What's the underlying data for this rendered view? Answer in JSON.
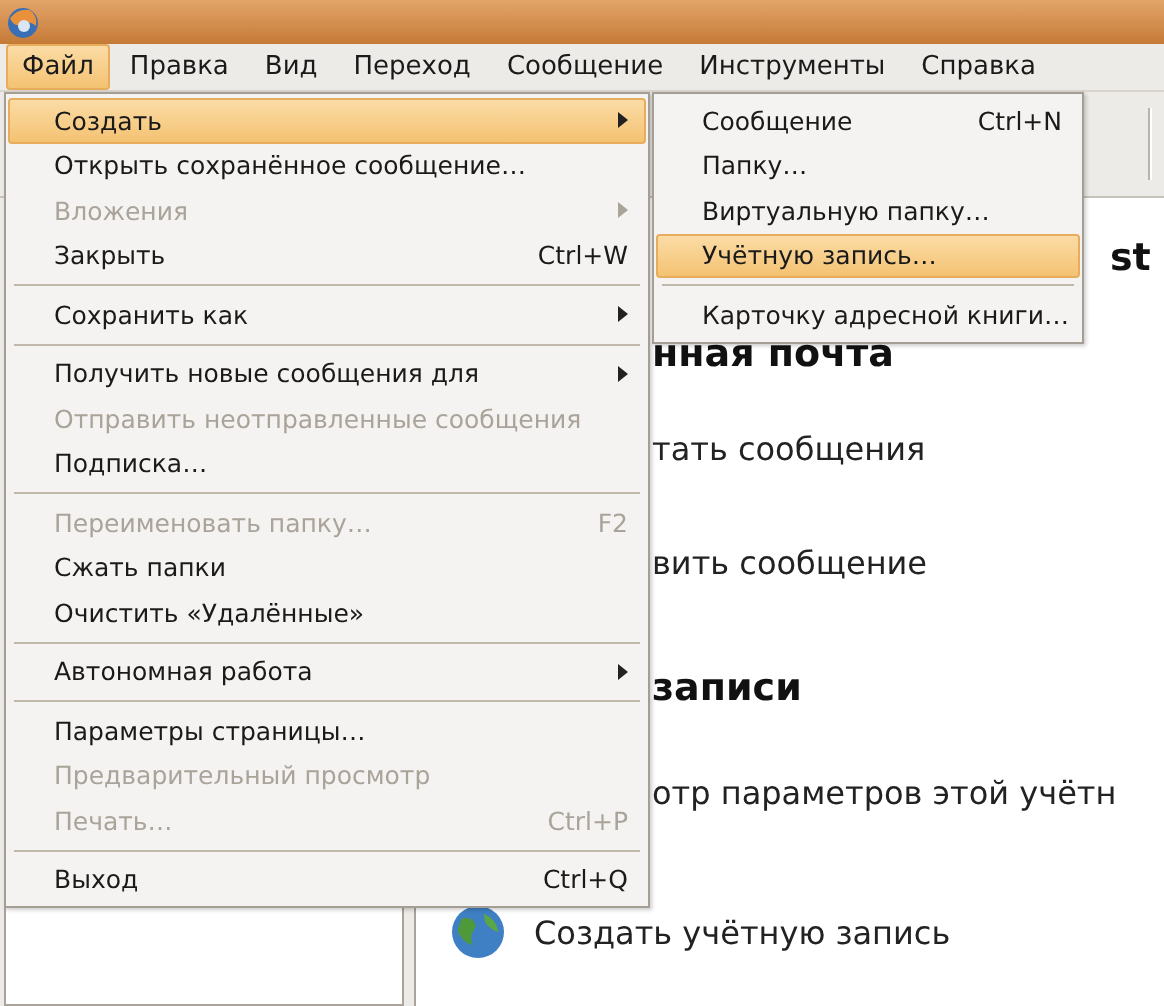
{
  "menubar": [
    {
      "label": "Файл",
      "selected": true
    },
    {
      "label": "Правка",
      "selected": false
    },
    {
      "label": "Вид",
      "selected": false
    },
    {
      "label": "Переход",
      "selected": false
    },
    {
      "label": "Сообщение",
      "selected": false
    },
    {
      "label": "Инструменты",
      "selected": false
    },
    {
      "label": "Справка",
      "selected": false
    }
  ],
  "file_menu": [
    {
      "kind": "item",
      "label": "Создать",
      "submenu": true,
      "selected": true,
      "disabled": false
    },
    {
      "kind": "item",
      "label": "Открыть сохранённое сообщение…",
      "selected": false,
      "disabled": false
    },
    {
      "kind": "item",
      "label": "Вложения",
      "submenu": true,
      "selected": false,
      "disabled": true
    },
    {
      "kind": "item",
      "label": "Закрыть",
      "shortcut": "Ctrl+W",
      "selected": false,
      "disabled": false
    },
    {
      "kind": "separator"
    },
    {
      "kind": "item",
      "label": "Сохранить как",
      "submenu": true,
      "selected": false,
      "disabled": false
    },
    {
      "kind": "separator"
    },
    {
      "kind": "item",
      "label": "Получить новые сообщения для",
      "submenu": true,
      "selected": false,
      "disabled": false
    },
    {
      "kind": "item",
      "label": "Отправить неотправленные сообщения",
      "selected": false,
      "disabled": true
    },
    {
      "kind": "item",
      "label": "Подписка…",
      "selected": false,
      "disabled": false
    },
    {
      "kind": "separator"
    },
    {
      "kind": "item",
      "label": "Переименовать папку…",
      "shortcut": "F2",
      "selected": false,
      "disabled": true
    },
    {
      "kind": "item",
      "label": "Сжать папки",
      "selected": false,
      "disabled": false
    },
    {
      "kind": "item",
      "label": "Очистить «Удалённые»",
      "selected": false,
      "disabled": false
    },
    {
      "kind": "separator"
    },
    {
      "kind": "item",
      "label": "Автономная работа",
      "submenu": true,
      "selected": false,
      "disabled": false
    },
    {
      "kind": "separator"
    },
    {
      "kind": "item",
      "label": "Параметры страницы…",
      "selected": false,
      "disabled": false
    },
    {
      "kind": "item",
      "label": "Предварительный просмотр",
      "selected": false,
      "disabled": true
    },
    {
      "kind": "item",
      "label": "Печать…",
      "shortcut": "Ctrl+P",
      "selected": false,
      "disabled": true
    },
    {
      "kind": "separator"
    },
    {
      "kind": "item",
      "label": "Выход",
      "shortcut": "Ctrl+Q",
      "selected": false,
      "disabled": false
    }
  ],
  "create_submenu": [
    {
      "kind": "item",
      "label": "Сообщение",
      "shortcut": "Ctrl+N",
      "selected": false
    },
    {
      "kind": "item",
      "label": "Папку…",
      "selected": false
    },
    {
      "kind": "item",
      "label": "Виртуальную папку…",
      "selected": false
    },
    {
      "kind": "item",
      "label": "Учётную запись…",
      "selected": true
    },
    {
      "kind": "separator"
    },
    {
      "kind": "item",
      "label": "Карточку адресной книги…",
      "selected": false
    }
  ],
  "content": [
    {
      "kind": "heading",
      "text": "st"
    },
    {
      "kind": "heading",
      "text": "нная почта"
    },
    {
      "kind": "item",
      "text": "тать сообщения"
    },
    {
      "kind": "item",
      "text": "вить сообщение"
    },
    {
      "kind": "heading",
      "text": "записи"
    },
    {
      "kind": "item",
      "text": "отр параметров этой учётн"
    },
    {
      "kind": "item-icon",
      "text": "Создать учётную запись"
    }
  ]
}
